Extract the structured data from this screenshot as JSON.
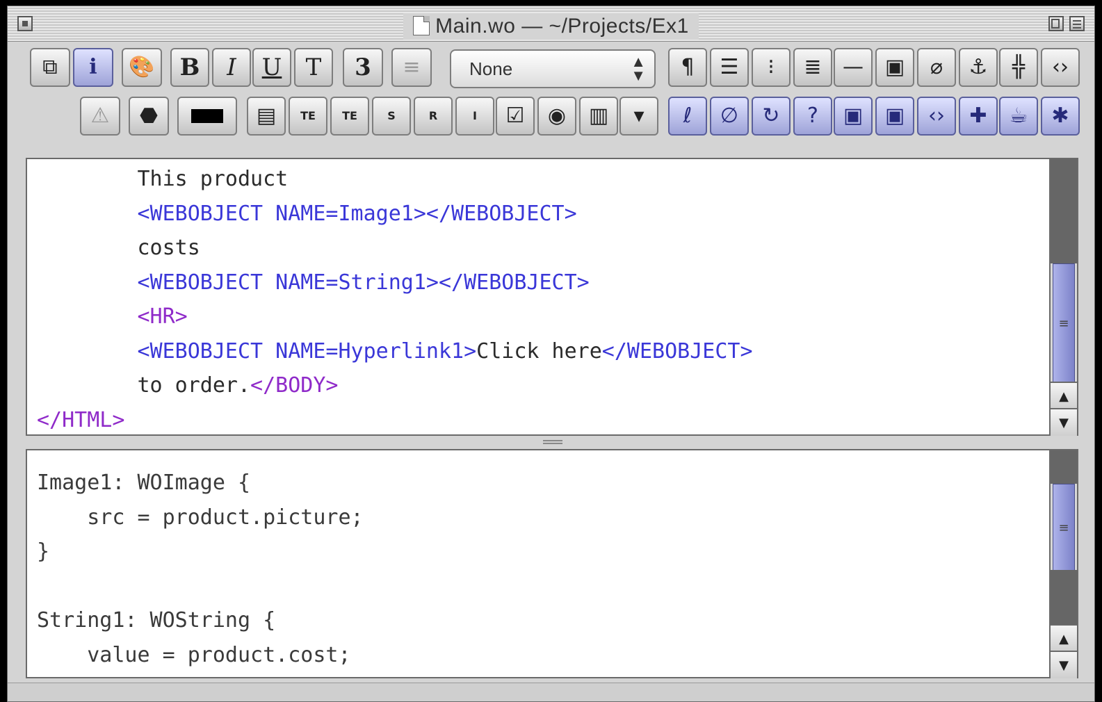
{
  "window": {
    "title": "Main.wo — ~/Projects/Ex1"
  },
  "toolbar": {
    "row1": [
      {
        "name": "duplicate-icon",
        "glyph": "⧉"
      },
      {
        "name": "info-icon",
        "glyph": "i"
      },
      {
        "name": "palette-icon",
        "glyph": "🎨"
      },
      {
        "name": "bold-button",
        "label": "B"
      },
      {
        "name": "italic-button",
        "label": "I"
      },
      {
        "name": "underline-button",
        "label": "U"
      },
      {
        "name": "teletype-button",
        "label": "T"
      },
      {
        "name": "font-size-button",
        "label": "3"
      },
      {
        "name": "align-icon",
        "glyph": "≡"
      }
    ],
    "style_popup": {
      "value": "None"
    },
    "row1_right": [
      {
        "name": "paragraph-icon",
        "glyph": "¶"
      },
      {
        "name": "text-block-icon",
        "glyph": "☰"
      },
      {
        "name": "bullet-list-icon",
        "glyph": "⁝"
      },
      {
        "name": "numbered-list-icon",
        "glyph": "≣"
      },
      {
        "name": "horizontal-rule-icon",
        "glyph": "—"
      },
      {
        "name": "image-icon",
        "glyph": "▣"
      },
      {
        "name": "link-icon",
        "glyph": "⌀"
      },
      {
        "name": "anchor-icon",
        "glyph": "⚓"
      },
      {
        "name": "frames-icon",
        "glyph": "╬"
      },
      {
        "name": "code-tag-icon",
        "glyph": "‹›"
      }
    ],
    "row2": [
      {
        "name": "warning-icon",
        "glyph": "⚠"
      },
      {
        "name": "component-icon",
        "glyph": "⬣"
      },
      {
        "name": "color-well",
        "glyph": ""
      },
      {
        "name": "form-icon",
        "glyph": "▤"
      },
      {
        "name": "text-field-icon",
        "glyph": "TE"
      },
      {
        "name": "text-area-icon",
        "glyph": "TE"
      },
      {
        "name": "submit-button-icon",
        "glyph": "S"
      },
      {
        "name": "reset-button-icon",
        "glyph": "R"
      },
      {
        "name": "image-button-icon",
        "glyph": "I"
      },
      {
        "name": "checkbox-icon",
        "glyph": "☑"
      },
      {
        "name": "radio-button-icon",
        "glyph": "◉"
      },
      {
        "name": "browser-list-icon",
        "glyph": "▥"
      },
      {
        "name": "popup-menu-icon",
        "glyph": "▾"
      },
      {
        "name": "repetition-icon",
        "glyph": "ℓ"
      },
      {
        "name": "conditional-icon",
        "glyph": "∅"
      },
      {
        "name": "refresh-icon",
        "glyph": "↻"
      },
      {
        "name": "help-icon",
        "glyph": "?"
      },
      {
        "name": "active-image-icon",
        "glyph": "▣"
      },
      {
        "name": "cursor-image-icon",
        "glyph": "▣"
      },
      {
        "name": "generic-element-icon",
        "glyph": "‹›"
      },
      {
        "name": "pin-icon",
        "glyph": "✚"
      },
      {
        "name": "java-applet-icon",
        "glyph": "☕"
      },
      {
        "name": "custom-element-icon",
        "glyph": "✱"
      }
    ]
  },
  "html_pane": {
    "lines": [
      [
        {
          "t": "        This product",
          "c": "text"
        }
      ],
      [
        {
          "t": "        <WEBOBJECT NAME=Image1></WEBOBJECT>",
          "c": "tag"
        }
      ],
      [
        {
          "t": "        costs",
          "c": "text"
        }
      ],
      [
        {
          "t": "        <WEBOBJECT NAME=String1></WEBOBJECT>",
          "c": "tag"
        }
      ],
      [
        {
          "t": "        <HR>",
          "c": "tag2"
        }
      ],
      [
        {
          "t": "        <WEBOBJECT NAME=Hyperlink1>",
          "c": "tag"
        },
        {
          "t": "Click here",
          "c": "text"
        },
        {
          "t": "</WEBOBJECT>",
          "c": "tag"
        }
      ],
      [
        {
          "t": "        to order.",
          "c": "text"
        },
        {
          "t": "</BODY>",
          "c": "tag2"
        }
      ],
      [
        {
          "t": "</HTML>",
          "c": "tag2"
        }
      ]
    ]
  },
  "declarations_pane": {
    "lines": [
      "Image1: WOImage {",
      "    src = product.picture;",
      "}",
      "",
      "String1: WOString {",
      "    value = product.cost;"
    ]
  },
  "scroll": {
    "html_pane_position": 0.6,
    "declarations_pane_position": 0.35
  },
  "colors": {
    "tag": "#3a37d8",
    "html_tag": "#8f2ac9",
    "text": "#2b2b2b",
    "scroll_thumb": "#9096d8"
  }
}
